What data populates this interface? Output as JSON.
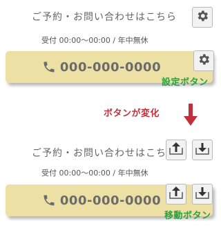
{
  "top": {
    "heading": "ご予約・お問い合わせはこちら",
    "hours": "受付 00:00〜00:00 / 年中無休",
    "phone": "000-000-0000",
    "caption": "設定ボタン"
  },
  "transition": {
    "caption": "ボタンが変化"
  },
  "bottom": {
    "heading": "ご予約・お問い合わせはこちら",
    "hours": "受付 00:00〜00:00 / 年中無休",
    "phone": "000-000-0000",
    "caption": "移動ボタン"
  },
  "colors": {
    "button_bg": "#ede0a5",
    "accent_green": "#2aa13c",
    "accent_red": "#c0303a"
  },
  "icons": [
    "gear-icon",
    "phone-icon",
    "move-up-icon",
    "move-down-icon",
    "arrow-down-icon"
  ]
}
